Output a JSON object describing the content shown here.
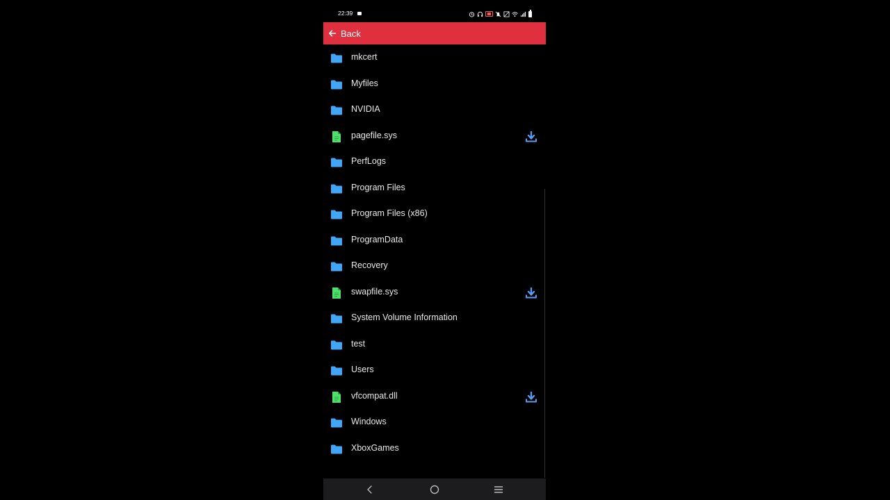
{
  "status_bar": {
    "time": "22:39"
  },
  "appbar": {
    "back_label": "Back",
    "color": "#e0303f"
  },
  "colors": {
    "folder": "#42a5f5",
    "file": "#4ee06a",
    "download": "#5b9bf0"
  },
  "files": [
    {
      "name": "mkcert",
      "type": "folder"
    },
    {
      "name": "Myfiles",
      "type": "folder"
    },
    {
      "name": "NVIDIA",
      "type": "folder"
    },
    {
      "name": "pagefile.sys",
      "type": "file",
      "downloadable": true
    },
    {
      "name": "PerfLogs",
      "type": "folder"
    },
    {
      "name": "Program Files",
      "type": "folder"
    },
    {
      "name": "Program Files (x86)",
      "type": "folder"
    },
    {
      "name": "ProgramData",
      "type": "folder"
    },
    {
      "name": "Recovery",
      "type": "folder"
    },
    {
      "name": "swapfile.sys",
      "type": "file",
      "downloadable": true
    },
    {
      "name": "System Volume Information",
      "type": "folder"
    },
    {
      "name": "test",
      "type": "folder"
    },
    {
      "name": "Users",
      "type": "folder"
    },
    {
      "name": "vfcompat.dll",
      "type": "file",
      "downloadable": true
    },
    {
      "name": "Windows",
      "type": "folder"
    },
    {
      "name": "XboxGames",
      "type": "folder"
    }
  ],
  "nav": {
    "icons": [
      "back-nav-icon",
      "home-nav-icon",
      "recents-nav-icon"
    ]
  }
}
